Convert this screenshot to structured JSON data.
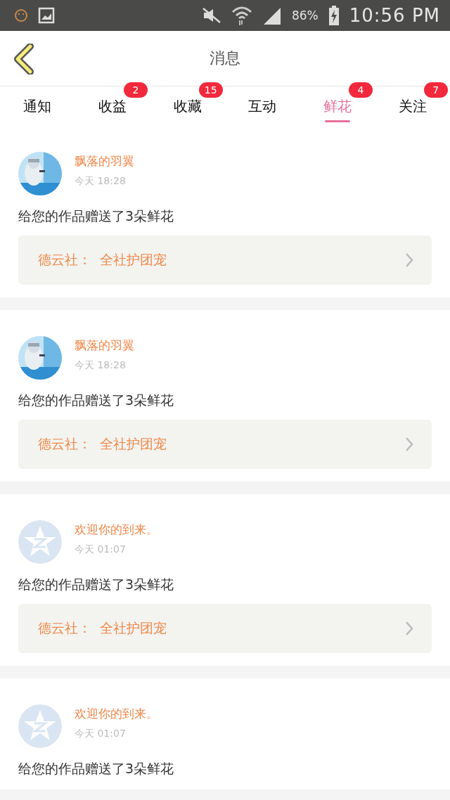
{
  "status_bar": {
    "battery": "86%",
    "time": "10:56 PM"
  },
  "header": {
    "title": "消息"
  },
  "tabs": [
    {
      "label": "通知",
      "selected": false
    },
    {
      "label": "收益",
      "selected": false,
      "badge": "2"
    },
    {
      "label": "收藏",
      "selected": false,
      "badge": "15"
    },
    {
      "label": "互动",
      "selected": false
    },
    {
      "label": "鲜花",
      "selected": true,
      "badge": "4"
    },
    {
      "label": "关注",
      "selected": false,
      "badge": "7"
    }
  ],
  "messages": [
    {
      "kind": "picture",
      "name": "飘落的羽翼",
      "time": "今天 18:28",
      "text": "给您的作品赠送了3朵鲜花",
      "link": "德云社：  全社护团宠"
    },
    {
      "kind": "picture",
      "name": "飘落的羽翼",
      "time": "今天 18:28",
      "text": "给您的作品赠送了3朵鲜花",
      "link": "德云社：  全社护团宠"
    },
    {
      "kind": "default",
      "name": "欢迎你的到来。",
      "time": "今天 01:07",
      "text": "给您的作品赠送了3朵鲜花",
      "link": "德云社：  全社护团宠"
    },
    {
      "kind": "default",
      "name": "欢迎你的到来。",
      "time": "今天 01:07",
      "text": "给您的作品赠送了3朵鲜花"
    }
  ]
}
